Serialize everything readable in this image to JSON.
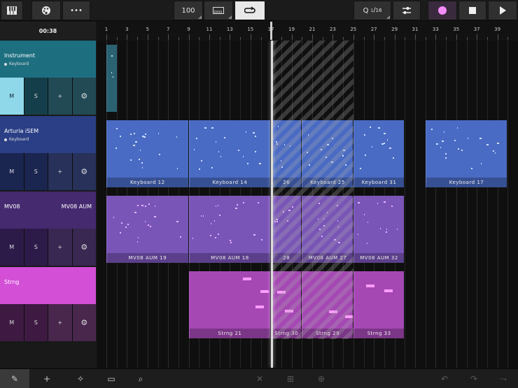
{
  "toolbar": {
    "tempo": "100",
    "quantize_q": "Q",
    "quantize_num": "1",
    "quantize_den": "16",
    "colors": {
      "record_dot": "#f58cff",
      "loop_active_bg": "#e8e8e8"
    }
  },
  "time_display": "00:38",
  "ruler_ticks": [
    "1",
    "3",
    "5",
    "7",
    "9",
    "11",
    "13",
    "15",
    "17",
    "19",
    "21",
    "23",
    "25",
    "27",
    "29",
    "31",
    "33",
    "35",
    "37",
    "39"
  ],
  "tracks": [
    {
      "name": "Instrument",
      "sub": "Keyboard",
      "right_label": "",
      "color": "#1d6f80",
      "ctrl_color": "#143f4a",
      "mute_active": true,
      "buttons": {
        "mute": "M",
        "solo": "S",
        "add": "+",
        "settings": "⚙"
      }
    },
    {
      "name": "Arturia iSEM",
      "sub": "Keyboard",
      "right_label": "",
      "color": "#2a3f85",
      "ctrl_color": "#1a2550",
      "mute_active": false,
      "buttons": {
        "mute": "M",
        "solo": "S",
        "add": "+",
        "settings": "⚙"
      }
    },
    {
      "name": "MV08",
      "sub": "",
      "right_label": "MV08 AUM",
      "color": "#452a70",
      "ctrl_color": "#2c1b48",
      "mute_active": false,
      "buttons": {
        "mute": "M",
        "solo": "S",
        "add": "+",
        "settings": "⚙"
      }
    },
    {
      "name": "Strng",
      "sub": "",
      "right_label": "",
      "color": "#d34fd6",
      "ctrl_color": "#3e1a42",
      "mute_active": false,
      "buttons": {
        "mute": "M",
        "solo": "S",
        "add": "+",
        "settings": "⚙"
      }
    }
  ],
  "add_track_label": "+",
  "regions": [
    {
      "lane": 0,
      "bar_start": 1,
      "bar_end": 2.1,
      "label": "",
      "color": "#2b6272"
    },
    {
      "lane": 1,
      "bar_start": 1,
      "bar_end": 9,
      "label": "Keyboard  12",
      "color": "#4a6bc4"
    },
    {
      "lane": 1,
      "bar_start": 9,
      "bar_end": 17,
      "label": "Keyboard  14",
      "color": "#4a6bc4"
    },
    {
      "lane": 1,
      "bar_start": 17,
      "bar_end": 20,
      "label": "26",
      "color": "#4a6bc4"
    },
    {
      "lane": 1,
      "bar_start": 20,
      "bar_end": 25,
      "label": "Keyboard  25",
      "color": "#4a6bc4"
    },
    {
      "lane": 1,
      "bar_start": 25,
      "bar_end": 30,
      "label": "Keyboard  31",
      "color": "#4a6bc4"
    },
    {
      "lane": 1,
      "bar_start": 32,
      "bar_end": 40,
      "label": "Keyboard  17",
      "color": "#4a6bc4"
    },
    {
      "lane": 2,
      "bar_start": 1,
      "bar_end": 9,
      "label": "MV08 AUM  19",
      "color": "#7a55b8"
    },
    {
      "lane": 2,
      "bar_start": 9,
      "bar_end": 17,
      "label": "MV08 AUM  18",
      "color": "#7a55b8"
    },
    {
      "lane": 2,
      "bar_start": 17,
      "bar_end": 20,
      "label": "28",
      "color": "#7a55b8"
    },
    {
      "lane": 2,
      "bar_start": 20,
      "bar_end": 25,
      "label": "MV08 AUM  27",
      "color": "#7a55b8"
    },
    {
      "lane": 2,
      "bar_start": 25,
      "bar_end": 30,
      "label": "MV08 AUM  32",
      "color": "#7a55b8"
    },
    {
      "lane": 3,
      "bar_start": 9,
      "bar_end": 17,
      "label": "Strng  21",
      "color": "#a548b4"
    },
    {
      "lane": 3,
      "bar_start": 17,
      "bar_end": 20,
      "label": "Strng  30",
      "color": "#a548b4"
    },
    {
      "lane": 3,
      "bar_start": 20,
      "bar_end": 25,
      "label": "Strng  29",
      "color": "#a548b4"
    },
    {
      "lane": 3,
      "bar_start": 25,
      "bar_end": 30,
      "label": "Strng  33",
      "color": "#a548b4"
    }
  ],
  "bottom_tools": {
    "pencil": "✎",
    "add": "+",
    "wand": "✧",
    "layout": "▭",
    "search": "⌕",
    "delete": "✕",
    "split": "⊞",
    "link": "⊕",
    "undo": "↶",
    "redo": "↷",
    "curve": "⤳"
  }
}
